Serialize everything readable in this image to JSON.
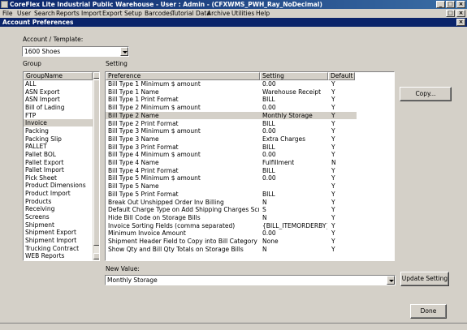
{
  "window": {
    "title": "CoreFlex Lite Industrial Public Warehouse - User : Admin - (CFXWMS_PWH_Ray_NoDecimal)"
  },
  "menu": [
    "File",
    "User",
    "Search",
    "Reports",
    "Import",
    "Export",
    "Setup",
    "Barcodes",
    "Tutorial Data",
    "Archive",
    "Utilities",
    "Help"
  ],
  "dialog": {
    "title": "Account Preferences",
    "account_label": "Account / Template:",
    "account_value": "1600 Shoes",
    "group_label": "Group",
    "setting_label": "Setting",
    "group_header": "GroupName",
    "groups": [
      "ALL",
      "ASN Export",
      "ASN Import",
      "Bill of Lading",
      "FTP",
      "Invoice",
      "Packing",
      "Packing Slip",
      "PALLET",
      "Pallet BOL",
      "Pallet Export",
      "Pallet Import",
      "Pick Sheet",
      "Product Dimensions",
      "Product Import",
      "Products",
      "Receiving",
      "Screens",
      "Shipment",
      "Shipment Export",
      "Shipment Import",
      "Trucking Contract",
      "WEB Reports"
    ],
    "selected_group": "Invoice",
    "columns": [
      "Preference",
      "Setting",
      "Default"
    ],
    "rows": [
      [
        "Bill Type 1 Minimum $ amount",
        "0.00",
        "Y"
      ],
      [
        "Bill Type 1 Name",
        "Warehouse Receipt",
        "Y"
      ],
      [
        "Bill Type 1 Print Format",
        "BILL",
        "Y"
      ],
      [
        "Bill Type 2 Minimum $ amount",
        "0.00",
        "Y"
      ],
      [
        "Bill Type 2 Name",
        "Monthly Storage",
        "Y"
      ],
      [
        "Bill Type 2 Print Format",
        "BILL",
        "Y"
      ],
      [
        "Bill Type 3 Minimum $ amount",
        "0.00",
        "Y"
      ],
      [
        "Bill Type 3 Name",
        "Extra Charges",
        "Y"
      ],
      [
        "Bill Type 3 Print Format",
        "BILL",
        "Y"
      ],
      [
        "Bill Type 4 Minimum $ amount",
        "0.00",
        "Y"
      ],
      [
        "Bill Type 4 Name",
        "Fulfillment",
        "N"
      ],
      [
        "Bill Type 4 Print Format",
        "BILL",
        "Y"
      ],
      [
        "Bill Type 5 Minimum $ amount",
        "0.00",
        "Y"
      ],
      [
        "Bill Type 5 Name",
        "",
        "Y"
      ],
      [
        "Bill Type 5 Print Format",
        "BILL",
        "Y"
      ],
      [
        "Break Out Unshipped Order Inv Billing",
        "N",
        "Y"
      ],
      [
        "Default Charge Type on Add Shipping Charges Screen",
        "S",
        "Y"
      ],
      [
        "Hide Bill Code on Storage Bills",
        "N",
        "Y"
      ],
      [
        "Invoice Sorting Fields (comma separated)",
        "{BILL_ITEMORDERBY}",
        "Y"
      ],
      [
        "Minimum Invoice Amount",
        "0.00",
        "Y"
      ],
      [
        "Shipment Header Field to Copy into Bill Category",
        "None",
        "Y"
      ],
      [
        "Show Qty and Bill Qty Totals on Storage Bills",
        "N",
        "Y"
      ]
    ],
    "selected_row": 4,
    "new_value_label": "New Value:",
    "new_value": "Monthly Storage",
    "copy_button": "Copy...",
    "update_button": "Update Setting",
    "done_button": "Done"
  }
}
